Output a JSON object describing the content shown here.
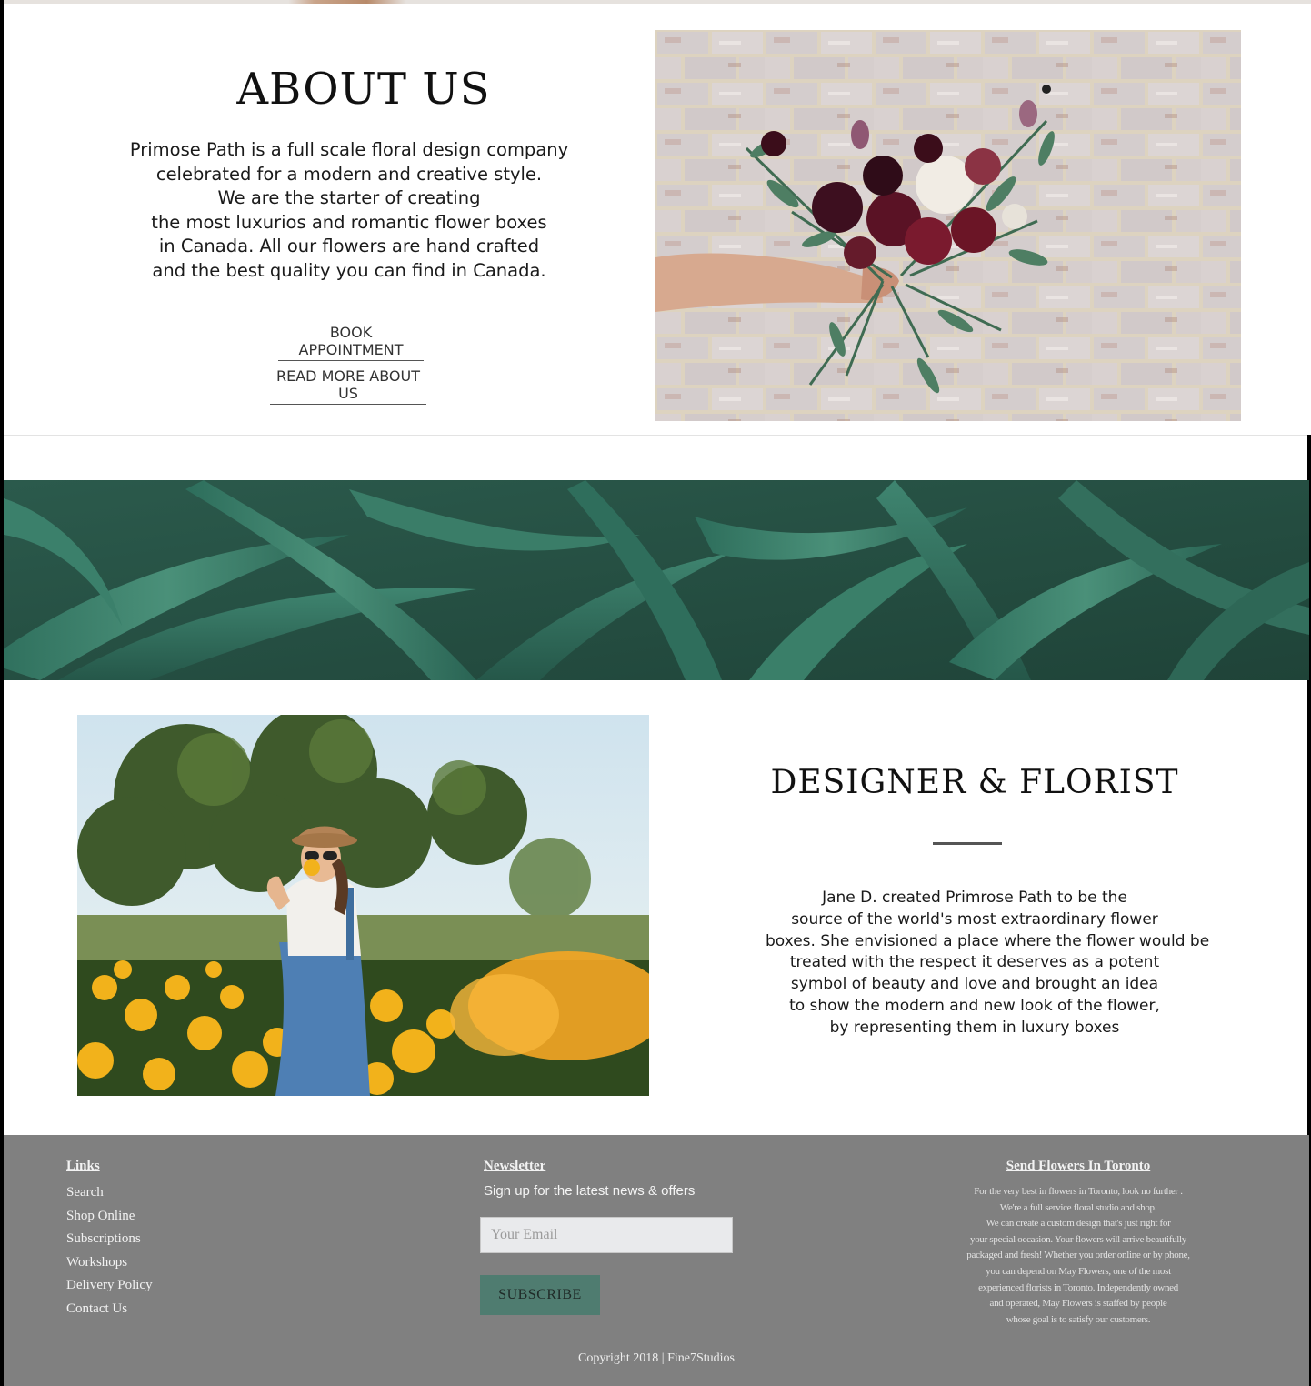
{
  "about": {
    "title": "ABOUT US",
    "paragraph_lines": [
      "Primose Path is a full scale floral design company",
      "celebrated for a modern and creative style.",
      "We are the starter of creating",
      "the most luxurios and romantic flower boxes",
      "in Canada. All our  flowers are hand crafted",
      "and the best quality you can find in Canada."
    ],
    "book_appointment_label": "BOOK APPOINTMENT",
    "read_more_label": "READ MORE ABOUT US"
  },
  "designer": {
    "title": "DESIGNER & FLORIST",
    "paragraph_lines": [
      "Jane D. created Primrose Path to be the",
      "source of the world's most extraordinary flower",
      "boxes. She envisioned a place where the flower would be",
      "treated with the respect it deserves as a potent",
      "symbol of beauty and love and brought an idea",
      "to show the modern and new look of the flower,",
      "by representing them in luxury boxes"
    ]
  },
  "footer": {
    "links_heading": "Links",
    "links": [
      "Search",
      "Shop Online",
      "Subscriptions",
      "Workshops",
      "Delivery Policy",
      "Contact Us"
    ],
    "newsletter_heading": "Newsletter",
    "newsletter_subtitle": "Sign  up for the latest news & offers",
    "email_placeholder": "Your Email",
    "subscribe_label": "SUBSCRIBE",
    "send_heading": "Send Flowers In Toronto",
    "send_lines": [
      "For the very best in flowers in Toronto,  look no further .",
      "We're a full service floral studio and shop.",
      "We can create a custom design that's just right for",
      "your special occasion. Your flowers will arrive beautifully",
      "packaged and fresh! Whether you order online or by phone,",
      "you can depend on May Flowers, one of the most",
      "experienced florists in Toronto. Independently owned",
      "and operated,  May Flowers is staffed by people",
      "whose goal is to satisfy our customers."
    ],
    "copyright": "Copyright 2018  |  Fine7Studios"
  },
  "colors": {
    "footer_bg": "#808080",
    "subscribe_bg": "#4f7c70",
    "leaf_green": "#2e6b5a"
  }
}
